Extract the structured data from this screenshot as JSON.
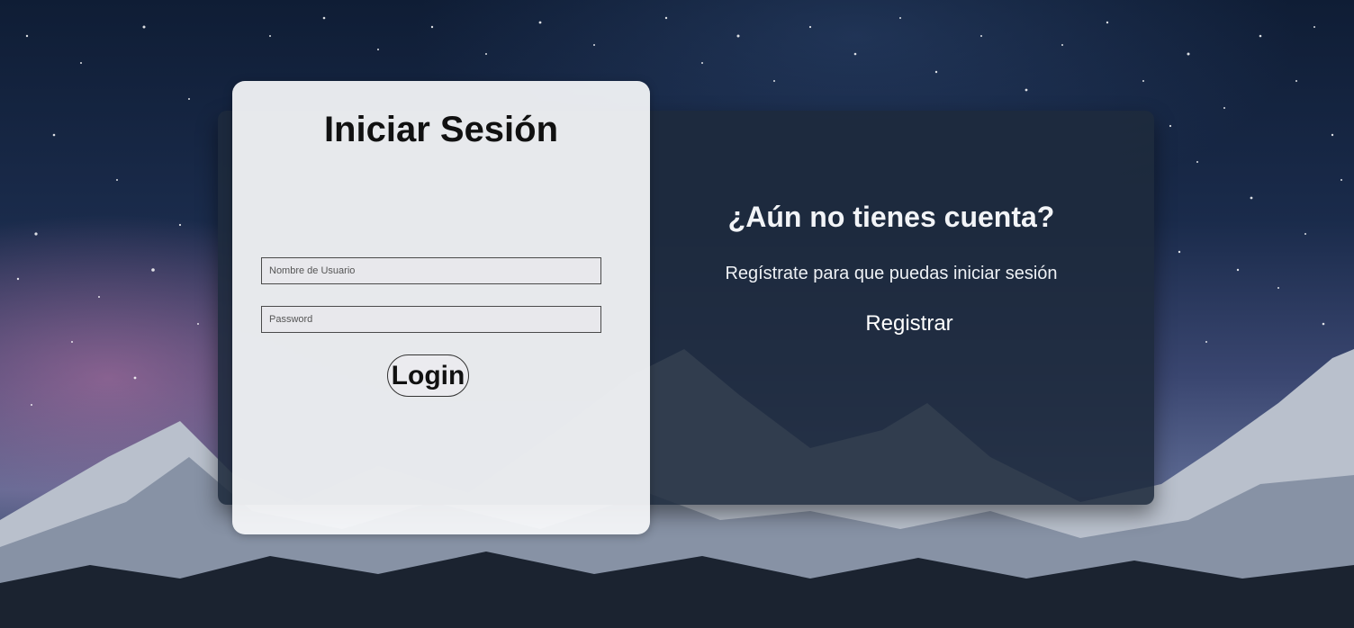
{
  "login": {
    "title": "Iniciar Sesión",
    "username_placeholder": "Nombre de Usuario",
    "password_placeholder": "Password",
    "login_label": "Login"
  },
  "register": {
    "title": "¿Aún no tienes cuenta?",
    "text": "Regístrate para que puedas iniciar sesión",
    "button_label": "Registrar"
  },
  "colors": {
    "dark_panel": "#1e2a3c",
    "card": "#f6f7fa",
    "title_text": "#111111",
    "panel_text": "#ffffff"
  }
}
